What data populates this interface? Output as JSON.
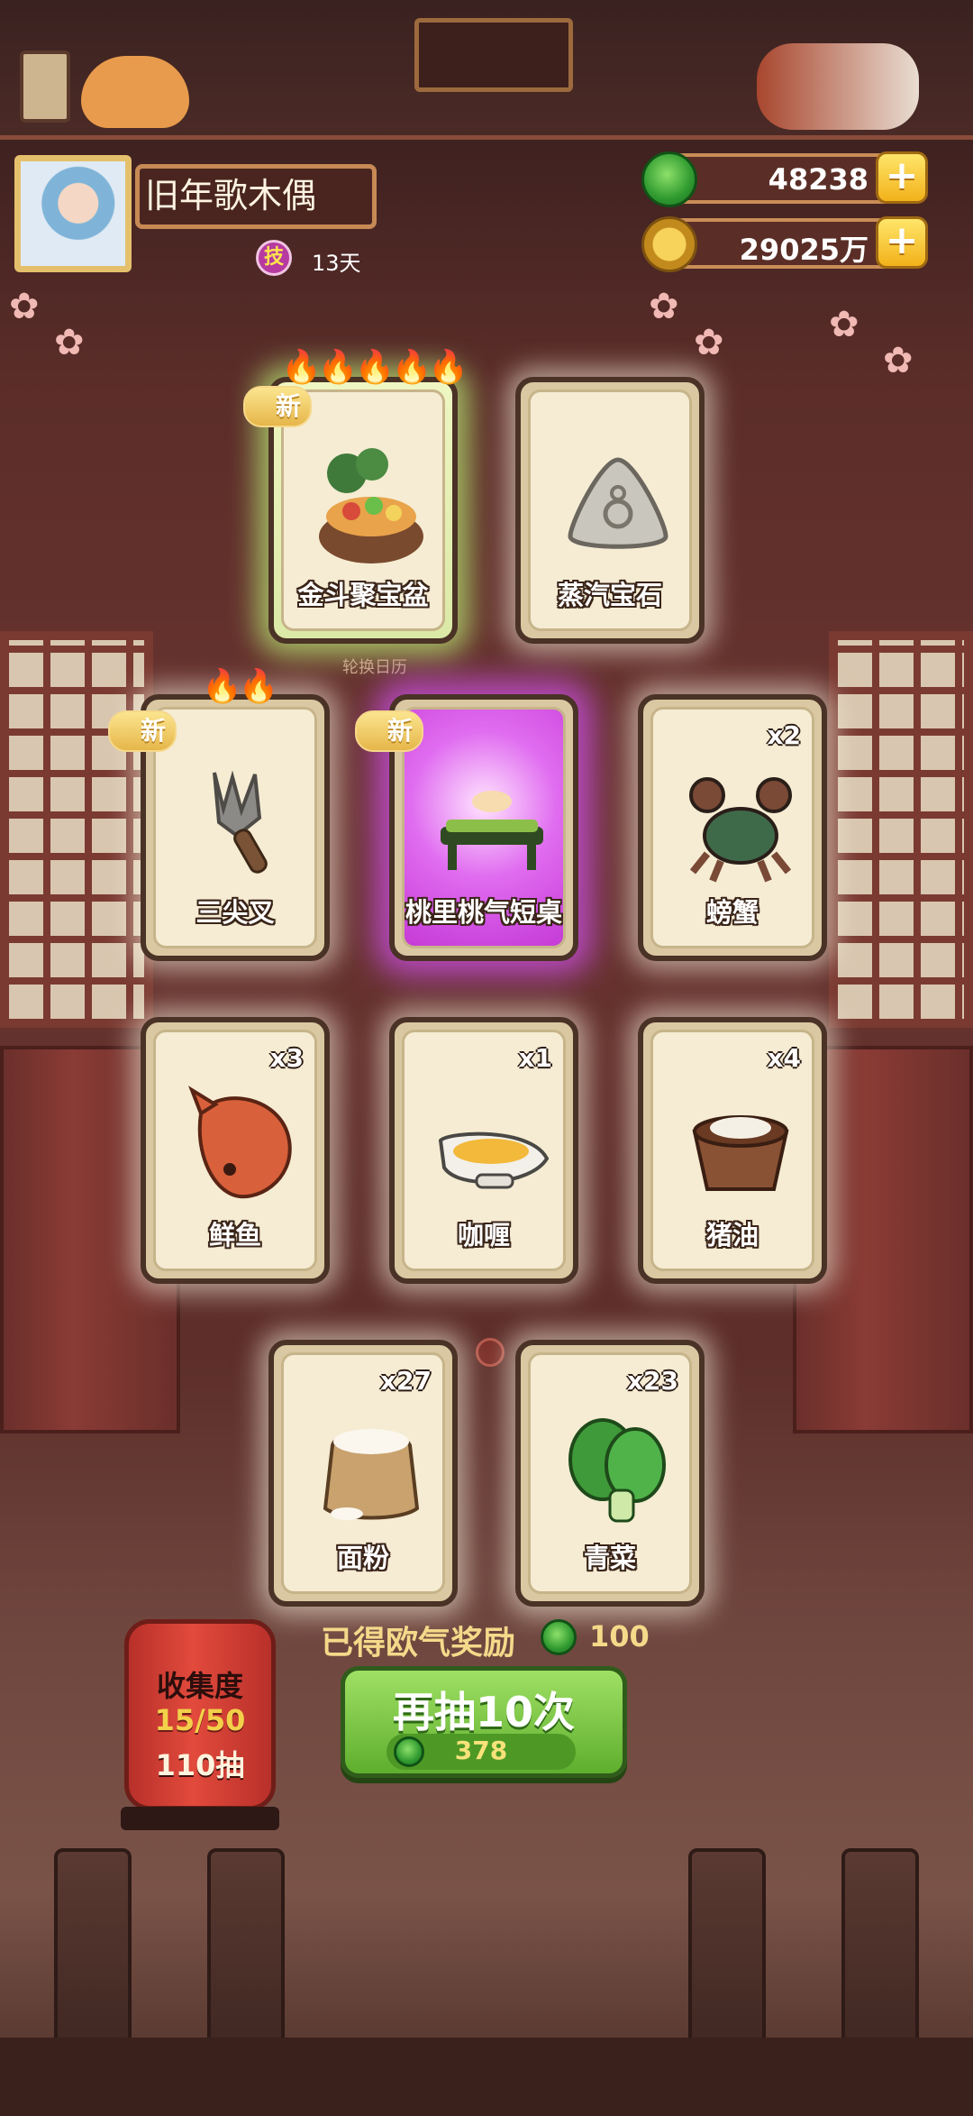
{
  "player": {
    "name": "旧年歌木偶",
    "skill_badge": "技",
    "days": "13天"
  },
  "currency": {
    "jade": "48238",
    "coins": "29025万"
  },
  "sub_label": "轮换日历",
  "new_tag": "新",
  "cards": [
    {
      "name": "金斗聚宝盆",
      "count": "",
      "is_new": true,
      "flames": "🔥🔥🔥🔥🔥"
    },
    {
      "name": "蒸汽宝石",
      "count": "",
      "is_new": false,
      "flames": ""
    },
    {
      "name": "三尖叉",
      "count": "",
      "is_new": true,
      "flames": "🔥🔥"
    },
    {
      "name": "桃里桃气短桌",
      "count": "",
      "is_new": true,
      "flames": ""
    },
    {
      "name": "螃蟹",
      "count": "x2",
      "is_new": false,
      "flames": ""
    },
    {
      "name": "鲜鱼",
      "count": "x3",
      "is_new": false,
      "flames": ""
    },
    {
      "name": "咖喱",
      "count": "x1",
      "is_new": false,
      "flames": ""
    },
    {
      "name": "猪油",
      "count": "x4",
      "is_new": false,
      "flames": ""
    },
    {
      "name": "面粉",
      "count": "x27",
      "is_new": false,
      "flames": ""
    },
    {
      "name": "青菜",
      "count": "x23",
      "is_new": false,
      "flames": ""
    }
  ],
  "reward": {
    "label": "已得欧气奖励",
    "value": "100"
  },
  "collection": {
    "title": "收集度",
    "progress": "15/50",
    "draws": "110抽"
  },
  "draw_button": {
    "label": "再抽10次",
    "cost": "378"
  },
  "colors": {
    "jade_green": "#3aa83a",
    "button_green": "#7cc84a",
    "lantern_red": "#d8423a",
    "card_border": "#4a3226"
  }
}
